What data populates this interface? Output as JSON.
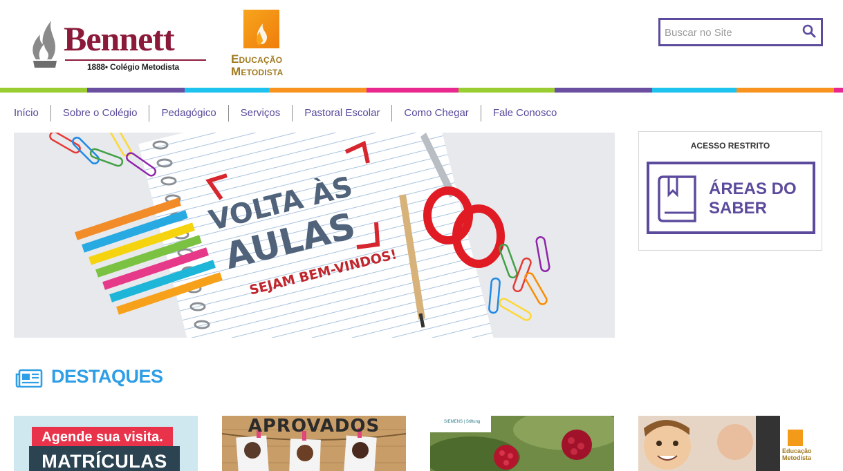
{
  "header": {
    "bennett_name": "Bennett",
    "bennett_tagline": "1888• Colégio Metodista",
    "edu_line1": "Educação",
    "edu_line2": "Metodista",
    "search_placeholder": "Buscar no Site"
  },
  "colorbar": [
    "#9acd32",
    "#6a4fa0",
    "#1ec2ee",
    "#f7931e",
    "#e8288e",
    "#9acd32",
    "#6a4fa0",
    "#1ec2ee",
    "#f7931e",
    "#e8288e"
  ],
  "nav": {
    "items": [
      "Início",
      "Sobre o Colégio",
      "Pedagógico",
      "Serviços",
      "Pastoral Escolar",
      "Como Chegar",
      "Fale Conosco"
    ]
  },
  "hero": {
    "line1": "VOLTA ÀS",
    "line2": "AULAS",
    "line3": "SEJAM BEM-VINDOS!"
  },
  "access": {
    "title": "ACESSO RESTRITO",
    "button_label": "ÁREAS DO SABER"
  },
  "destaques": {
    "title": "DESTAQUES",
    "cards": [
      {
        "top_text": "Agende sua visita.",
        "main_text": "MATRÍCULAS"
      },
      {
        "title": "APROVADOS"
      },
      {
        "label": "SIEMENS | Stiftung"
      },
      {
        "edu_line1": "Educação",
        "edu_line2": "Metodista"
      }
    ]
  },
  "colors": {
    "brand_purple": "#5c4a9c",
    "bennett_red": "#8b1a3a",
    "destaques_blue": "#2e9ee6"
  }
}
